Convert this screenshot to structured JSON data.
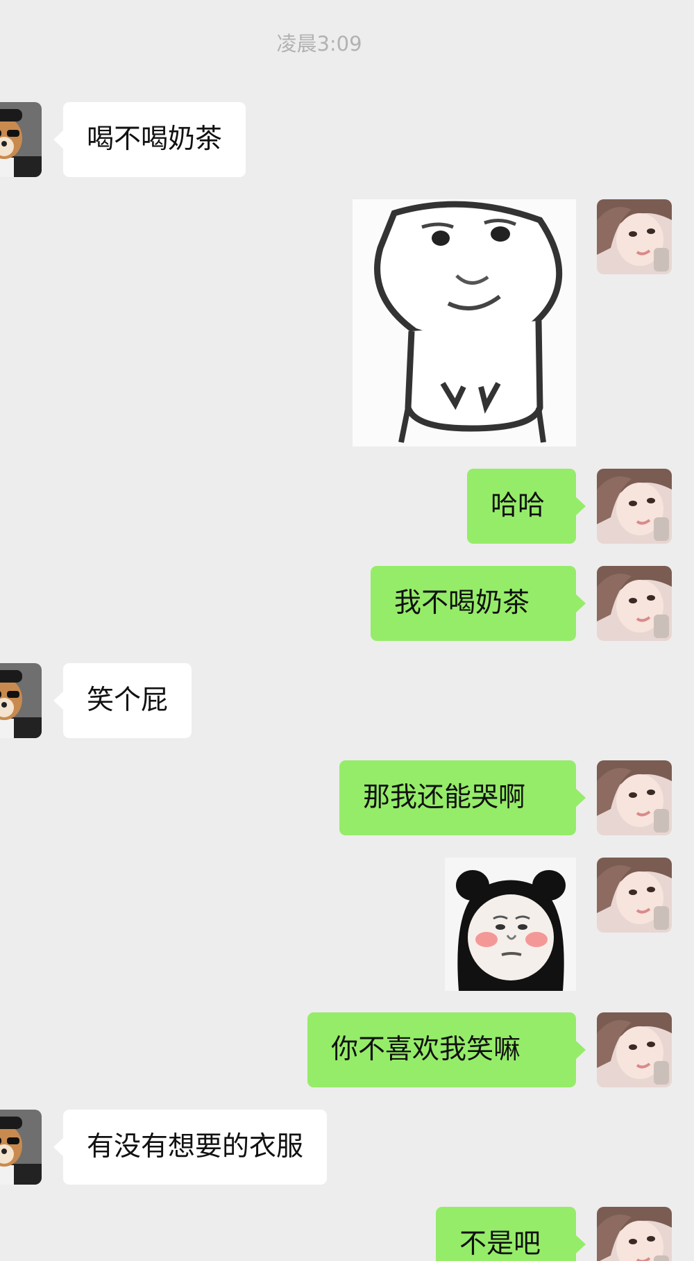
{
  "chat": {
    "timestamp": "凌晨3:09",
    "messages": [
      {
        "sender": "other",
        "type": "text",
        "text": "喝不喝奶茶"
      },
      {
        "sender": "me",
        "type": "sticker",
        "sticker": "drawn-face-sticker"
      },
      {
        "sender": "me",
        "type": "text",
        "text": "哈哈"
      },
      {
        "sender": "me",
        "type": "text",
        "text": "我不喝奶茶"
      },
      {
        "sender": "other",
        "type": "text",
        "text": "笑个屁"
      },
      {
        "sender": "me",
        "type": "text",
        "text": "那我还能哭啊"
      },
      {
        "sender": "me",
        "type": "sticker",
        "sticker": "panda-blush-sticker"
      },
      {
        "sender": "me",
        "type": "text",
        "text": "你不喜欢我笑嘛"
      },
      {
        "sender": "other",
        "type": "text",
        "text": "有没有想要的衣服"
      },
      {
        "sender": "me",
        "type": "text",
        "text": "不是吧"
      }
    ]
  },
  "colors": {
    "background": "#ededed",
    "my_bubble": "#95ec69",
    "other_bubble": "#ffffff",
    "timestamp_text": "#b2b2b2"
  }
}
